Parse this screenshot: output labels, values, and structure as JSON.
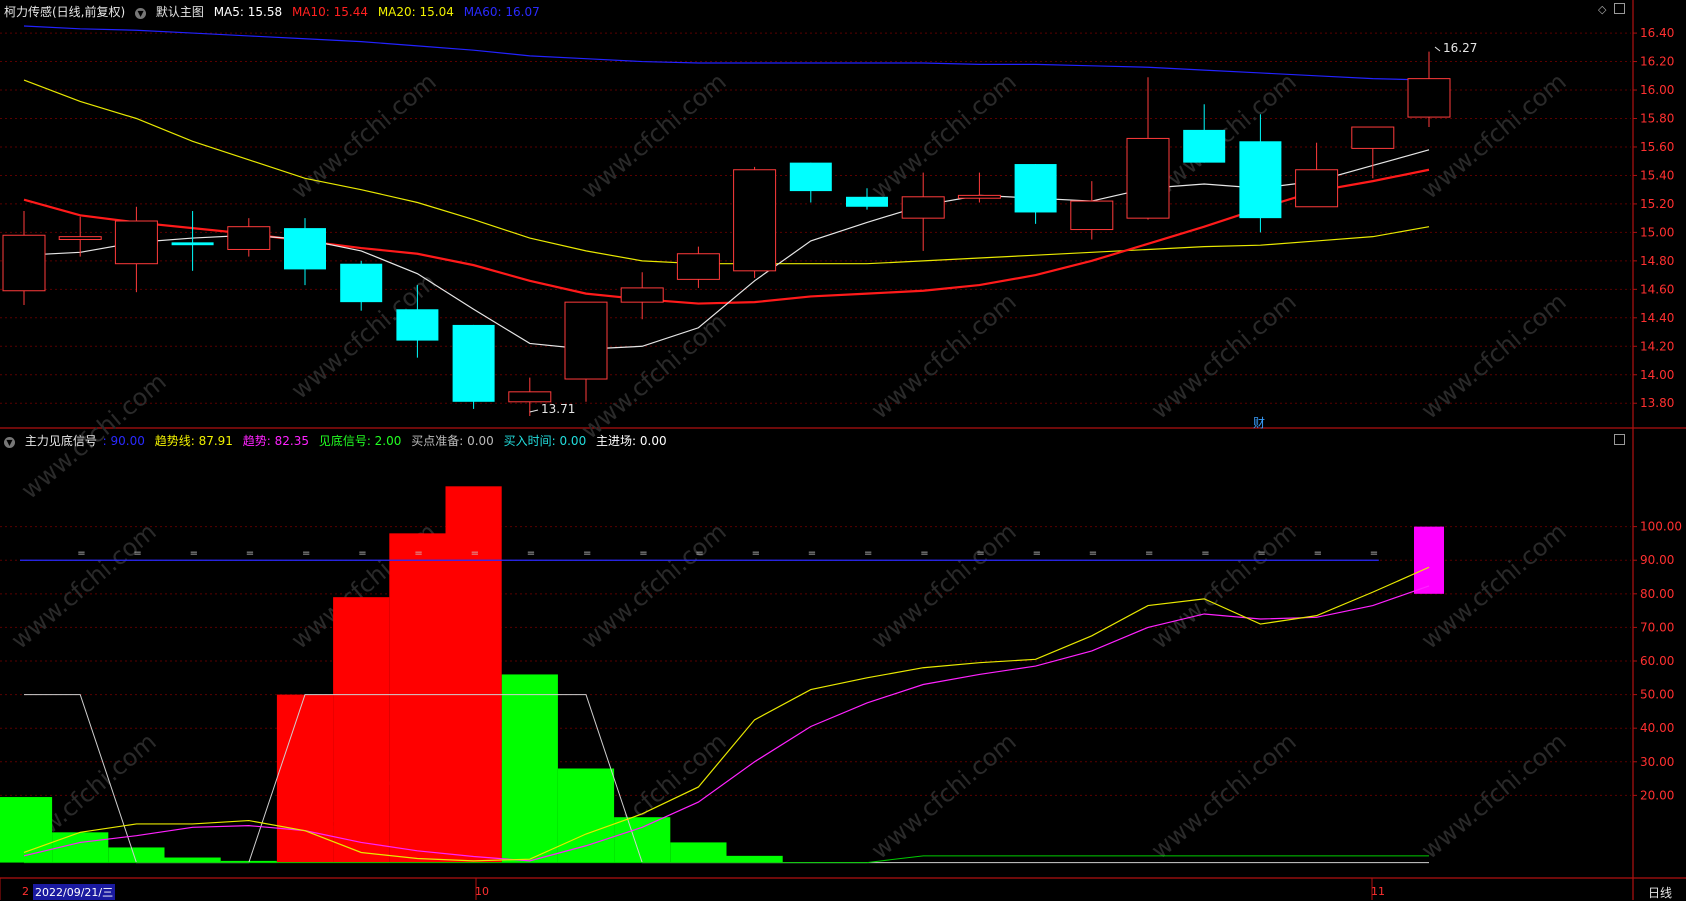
{
  "header": {
    "stock": "柯力传感(日线,前复权)",
    "main_chart": "默认主图",
    "ma": [
      {
        "label": "MA5: 15.58",
        "color": "#ffffff"
      },
      {
        "label": "MA10: 15.44",
        "color": "#ff2020"
      },
      {
        "label": "MA20: 15.04",
        "color": "#f0f000"
      },
      {
        "label": "MA60: 16.07",
        "color": "#2222ff"
      }
    ]
  },
  "sub_header": {
    "name": "主力见底信号",
    "items": [
      {
        "label": ": 90.00",
        "color": "#2a2aff"
      },
      {
        "label": "趋势线: 87.91",
        "color": "#f0f000"
      },
      {
        "label": "趋势: 82.35",
        "color": "#ff22ff"
      },
      {
        "label": "见底信号: 2.00",
        "color": "#22ff22"
      },
      {
        "label": "买点准备: 0.00",
        "color": "#bbbbbb"
      },
      {
        "label": "买入时间: 0.00",
        "color": "#22dddd"
      },
      {
        "label": "主进场: 0.00",
        "color": "#ffffff"
      }
    ]
  },
  "annotations": {
    "high": "16.27",
    "low": "13.71",
    "fin_marker": "财"
  },
  "x_axis": {
    "first_date": "2022/09/21/三",
    "tick_oct": "10",
    "tick_nov": "11",
    "tick_prev": "2"
  },
  "period_label": "日线",
  "watermark": "www.cfchi.com",
  "chart_data": [
    {
      "type": "candlestick",
      "ylim": [
        13.64,
        16.52
      ],
      "yticks": [
        "16.40",
        "16.20",
        "16.00",
        "15.80",
        "15.60",
        "15.40",
        "15.20",
        "15.00",
        "14.80",
        "14.60",
        "14.40",
        "14.20",
        "14.00",
        "13.80"
      ],
      "candles": [
        {
          "o": 14.59,
          "h": 15.15,
          "l": 14.49,
          "c": 14.98
        },
        {
          "o": 14.95,
          "h": 15.11,
          "l": 14.83,
          "c": 14.97
        },
        {
          "o": 14.78,
          "h": 15.18,
          "l": 14.58,
          "c": 15.08
        },
        {
          "o": 14.93,
          "h": 15.15,
          "l": 14.73,
          "c": 14.91
        },
        {
          "o": 14.88,
          "h": 15.1,
          "l": 14.83,
          "c": 15.04
        },
        {
          "o": 15.03,
          "h": 15.1,
          "l": 14.63,
          "c": 14.74
        },
        {
          "o": 14.78,
          "h": 14.8,
          "l": 14.45,
          "c": 14.51
        },
        {
          "o": 14.46,
          "h": 14.63,
          "l": 14.12,
          "c": 14.24
        },
        {
          "o": 14.35,
          "h": 14.35,
          "l": 13.76,
          "c": 13.81
        },
        {
          "o": 13.81,
          "h": 13.98,
          "l": 13.71,
          "c": 13.88
        },
        {
          "o": 13.97,
          "h": 14.49,
          "l": 13.81,
          "c": 14.51
        },
        {
          "o": 14.51,
          "h": 14.72,
          "l": 14.39,
          "c": 14.61
        },
        {
          "o": 14.67,
          "h": 14.9,
          "l": 14.61,
          "c": 14.85
        },
        {
          "o": 14.73,
          "h": 15.46,
          "l": 14.68,
          "c": 15.44
        },
        {
          "o": 15.49,
          "h": 15.49,
          "l": 15.21,
          "c": 15.29
        },
        {
          "o": 15.25,
          "h": 15.31,
          "l": 15.16,
          "c": 15.18
        },
        {
          "o": 15.1,
          "h": 15.42,
          "l": 14.87,
          "c": 15.25
        },
        {
          "o": 15.24,
          "h": 15.42,
          "l": 15.21,
          "c": 15.26
        },
        {
          "o": 15.48,
          "h": 15.48,
          "l": 15.06,
          "c": 15.14
        },
        {
          "o": 15.02,
          "h": 15.36,
          "l": 14.95,
          "c": 15.22
        },
        {
          "o": 15.1,
          "h": 16.09,
          "l": 15.09,
          "c": 15.66
        },
        {
          "o": 15.72,
          "h": 15.9,
          "l": 15.49,
          "c": 15.49
        },
        {
          "o": 15.64,
          "h": 15.83,
          "l": 15.0,
          "c": 15.1
        },
        {
          "o": 15.18,
          "h": 15.63,
          "l": 15.18,
          "c": 15.44
        },
        {
          "o": 15.59,
          "h": 15.74,
          "l": 15.38,
          "c": 15.74
        },
        {
          "o": 15.81,
          "h": 16.27,
          "l": 15.74,
          "c": 16.08
        }
      ],
      "ma5": [
        14.84,
        14.86,
        14.93,
        14.96,
        14.98,
        14.95,
        14.87,
        14.71,
        14.46,
        14.22,
        14.18,
        14.2,
        14.33,
        14.66,
        14.94,
        15.07,
        15.19,
        15.26,
        15.24,
        15.22,
        15.31,
        15.34,
        15.31,
        15.36,
        15.47,
        15.58
      ],
      "ma10": [
        15.23,
        15.12,
        15.07,
        15.03,
        14.99,
        14.94,
        14.89,
        14.85,
        14.77,
        14.66,
        14.57,
        14.53,
        14.5,
        14.51,
        14.55,
        14.57,
        14.59,
        14.63,
        14.7,
        14.8,
        14.92,
        15.04,
        15.17,
        15.29,
        15.36,
        15.44
      ],
      "ma20": [
        16.07,
        15.92,
        15.8,
        15.64,
        15.51,
        15.38,
        15.3,
        15.21,
        15.09,
        14.96,
        14.87,
        14.8,
        14.78,
        14.78,
        14.78,
        14.78,
        14.8,
        14.82,
        14.84,
        14.86,
        14.88,
        14.9,
        14.91,
        14.94,
        14.97,
        15.04
      ],
      "ma60": [
        16.45,
        16.43,
        16.42,
        16.4,
        16.38,
        16.36,
        16.34,
        16.31,
        16.28,
        16.24,
        16.22,
        16.2,
        16.19,
        16.19,
        16.19,
        16.19,
        16.19,
        16.18,
        16.18,
        16.17,
        16.16,
        16.14,
        16.12,
        16.1,
        16.08,
        16.07
      ]
    },
    {
      "type": "bar",
      "ylim": [
        -4,
        124
      ],
      "yticks": [
        "100.00",
        "90.00",
        "80.00",
        "70.00",
        "60.00",
        "50.00",
        "40.00",
        "30.00",
        "20.00"
      ],
      "red_bars": [
        0,
        0,
        0,
        0,
        0,
        50,
        79,
        98,
        112,
        0,
        0,
        0,
        0,
        0,
        0,
        0,
        0,
        0,
        0,
        0,
        0,
        0,
        0,
        0,
        0,
        0
      ],
      "green_bars": [
        19.5,
        9,
        4.5,
        1.5,
        0.5,
        0,
        0,
        0,
        0,
        56,
        28,
        13.5,
        6,
        2,
        0,
        0,
        0,
        0,
        0,
        0,
        0,
        0,
        0,
        0,
        0,
        0
      ],
      "magenta_bar": {
        "index": 25,
        "from": 80,
        "to": 100
      },
      "ref_line": 90,
      "trend_line": [
        3,
        9,
        11.5,
        11.5,
        12.5,
        9.5,
        3,
        1.2,
        0.5,
        1,
        8.5,
        14.5,
        22.5,
        42.5,
        51.5,
        55,
        58,
        59.5,
        60.5,
        67.5,
        76.5,
        78.5,
        71,
        73.5,
        80.5,
        87.91
      ],
      "trend": [
        2,
        6,
        8,
        10.5,
        11,
        9.5,
        6,
        3.5,
        1.8,
        0.5,
        5,
        10.5,
        18,
        30,
        40.5,
        47.5,
        53,
        56,
        58.5,
        63,
        70,
        74,
        72.5,
        73,
        76.5,
        82.35
      ],
      "white_line": [
        50,
        50,
        0,
        0,
        0,
        50,
        50,
        50,
        50,
        50,
        50,
        0,
        0,
        0,
        0,
        0,
        0,
        0,
        0,
        0,
        0,
        0,
        0,
        0,
        0,
        0
      ],
      "signal_line": [
        0,
        0,
        0,
        0,
        0,
        0,
        0,
        0,
        0,
        0,
        0,
        0,
        0,
        0,
        0,
        0,
        2,
        2,
        2,
        2,
        2,
        2,
        2,
        2,
        2,
        2
      ]
    }
  ]
}
